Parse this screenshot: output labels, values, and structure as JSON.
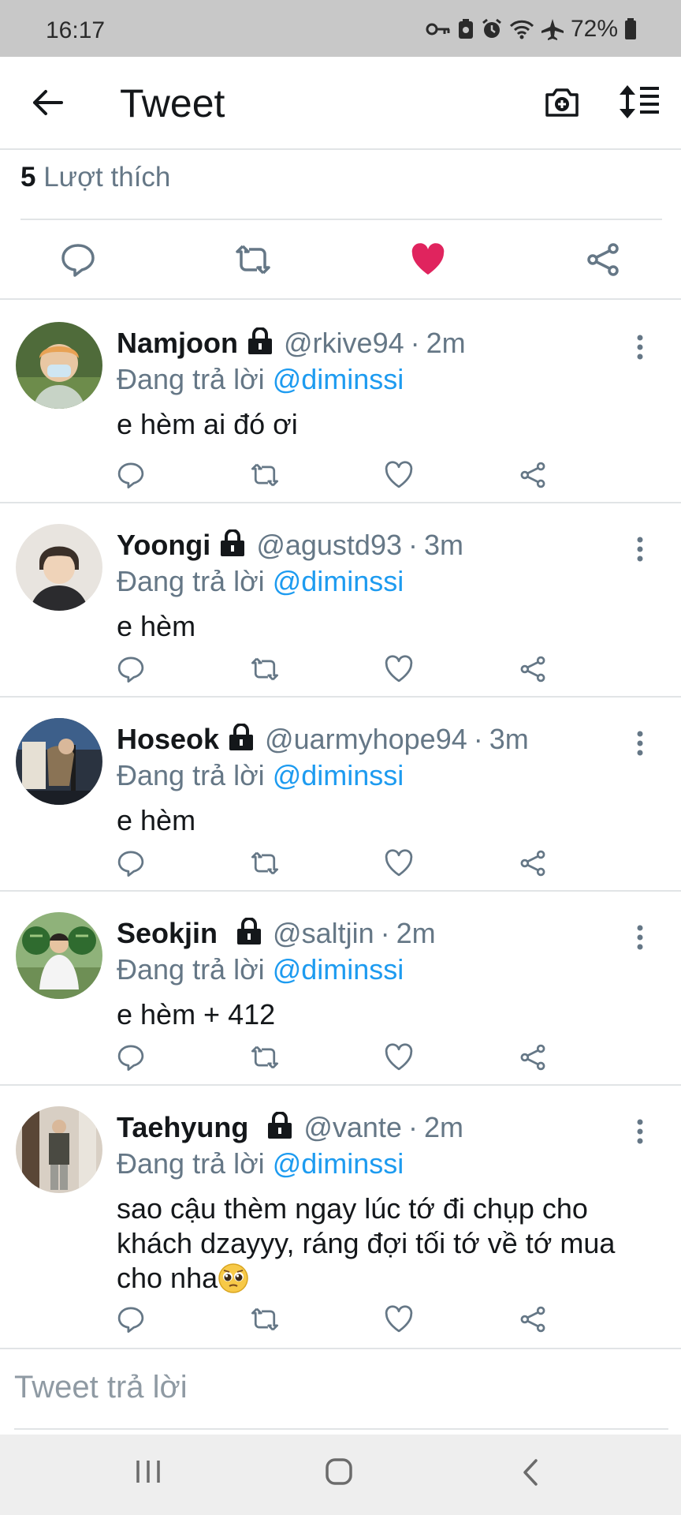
{
  "status": {
    "time": "16:17",
    "battery": "72%"
  },
  "header": {
    "title": "Tweet"
  },
  "likes": {
    "count": "5",
    "label": "Lượt thích"
  },
  "colors": {
    "accent": "#1d9bf0",
    "like_active": "#e0245e",
    "muted": "#657786"
  },
  "replies": [
    {
      "name": "Namjoon",
      "handle": "@rkive94",
      "sep": "·",
      "time": "2m",
      "reply_prefix": "Đang trả lời",
      "reply_to": "@diminssi",
      "text": "e hèm ai đó ơi"
    },
    {
      "name": "Yoongi",
      "handle": "@agustd93",
      "sep": "·",
      "time": "3m",
      "reply_prefix": "Đang trả lời",
      "reply_to": "@diminssi",
      "text": "e hèm"
    },
    {
      "name": "Hoseok",
      "handle": "@uarmyhope94",
      "sep": "·",
      "time": "3m",
      "reply_prefix": "Đang trả lời",
      "reply_to": "@diminssi",
      "text": "e hèm"
    },
    {
      "name": "Seokjin",
      "handle": "@saltjin",
      "sep": "·",
      "time": "2m",
      "reply_prefix": "Đang trả lời",
      "reply_to": "@diminssi",
      "text": "e hèm + 412"
    },
    {
      "name": "Taehyung",
      "handle": "@vante",
      "sep": "·",
      "time": "2m",
      "reply_prefix": "Đang trả lời",
      "reply_to": "@diminssi",
      "text": "sao cậu thèm ngay lúc tớ đi chụp cho khách dzayyy, ráng đợi tối tớ về tớ mua cho nha"
    }
  ],
  "compose": {
    "placeholder": "Tweet trả lời"
  },
  "icons": {
    "back": "arrow-left-icon",
    "camera": "camera-plus-icon",
    "sort": "sort-icon",
    "reply": "reply-icon",
    "retweet": "retweet-icon",
    "like": "heart-icon",
    "share": "share-icon",
    "lock": "lock-icon",
    "more": "more-vertical-icon",
    "emoji": "pleading-face-emoji"
  }
}
